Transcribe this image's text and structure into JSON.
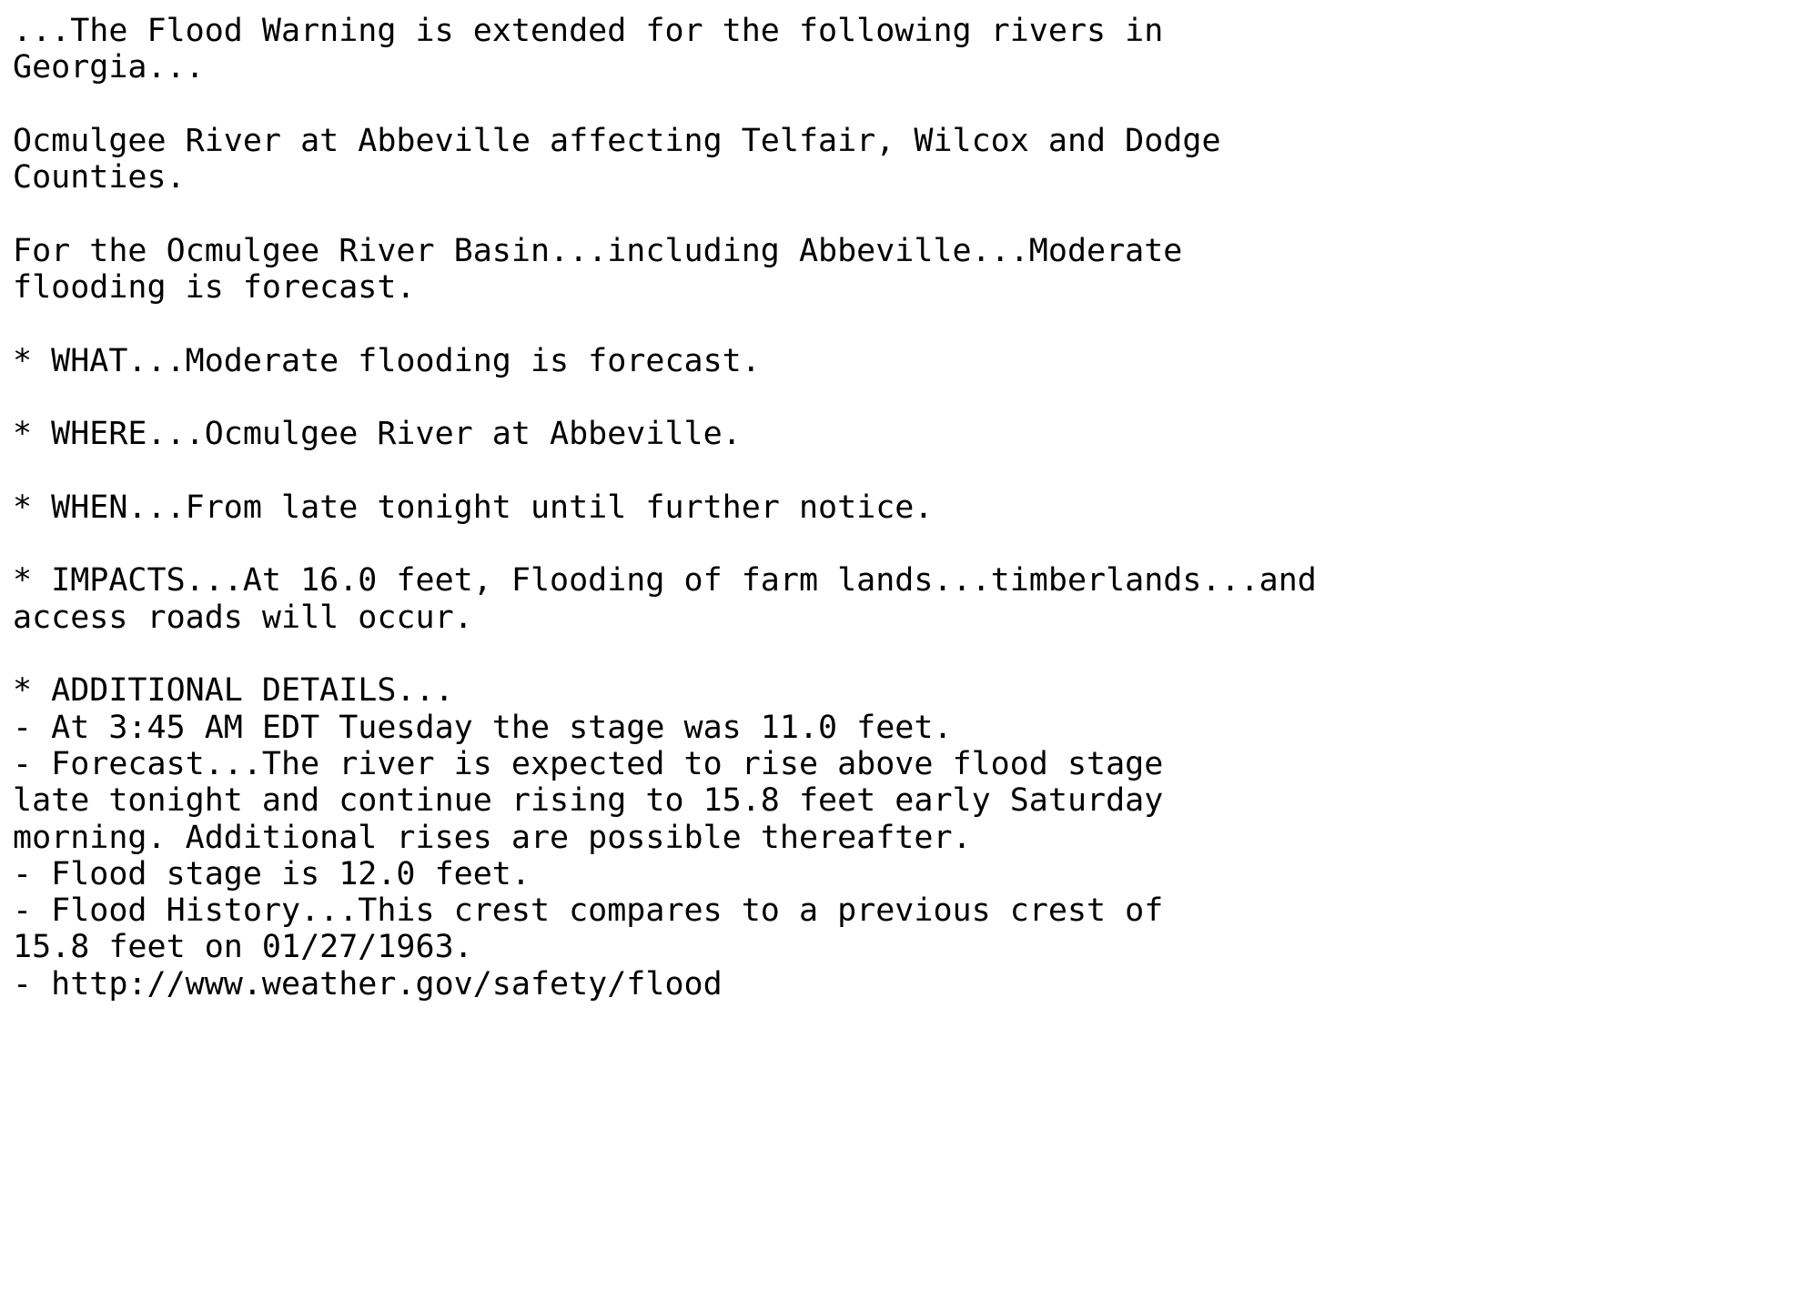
{
  "document": {
    "type": "nws-text-product",
    "product_name": "Flood Warning",
    "text_color": "#000000",
    "background_color": "#ffffff",
    "blocks": [
      {
        "id": "headline",
        "name": "headline-paragraph",
        "lines": [
          "...The Flood Warning is extended for the following rivers in",
          "Georgia..."
        ]
      },
      {
        "id": "location",
        "name": "affected-location-paragraph",
        "lines": [
          "Ocmulgee River at Abbeville affecting Telfair, Wilcox and Dodge",
          "Counties."
        ]
      },
      {
        "id": "basin",
        "name": "basin-summary-paragraph",
        "lines": [
          "For the Ocmulgee River Basin...including Abbeville...Moderate",
          "flooding is forecast."
        ]
      },
      {
        "id": "what",
        "name": "what-bullet",
        "lines": [
          "* WHAT...Moderate flooding is forecast."
        ]
      },
      {
        "id": "where",
        "name": "where-bullet",
        "lines": [
          "* WHERE...Ocmulgee River at Abbeville."
        ]
      },
      {
        "id": "when",
        "name": "when-bullet",
        "lines": [
          "* WHEN...From late tonight until further notice."
        ]
      },
      {
        "id": "impacts",
        "name": "impacts-bullet",
        "lines": [
          "* IMPACTS...At 16.0 feet, Flooding of farm lands...timberlands...and",
          "access roads will occur."
        ]
      },
      {
        "id": "additional",
        "name": "additional-details-bullet",
        "lines": [
          "* ADDITIONAL DETAILS...",
          "- At 3:45 AM EDT Tuesday the stage was 11.0 feet.",
          "- Forecast...The river is expected to rise above flood stage",
          "late tonight and continue rising to 15.8 feet early Saturday",
          "morning. Additional rises are possible thereafter.",
          "- Flood stage is 12.0 feet.",
          "- Flood History...This crest compares to a previous crest of",
          "15.8 feet on 01/27/1963.",
          "- http://www.weather.gov/safety/flood"
        ]
      }
    ],
    "values": {
      "river": "Ocmulgee River",
      "gauge_location": "Abbeville",
      "state": "Georgia",
      "counties": [
        "Telfair",
        "Wilcox",
        "Dodge"
      ],
      "severity": "Moderate",
      "impact_stage_feet": "16.0",
      "observation_time": "3:45 AM EDT Tuesday",
      "observed_stage_feet": "11.0",
      "forecast_crest_feet": "15.8",
      "forecast_crest_time": "early Saturday morning",
      "flood_stage_feet": "12.0",
      "previous_crest_feet": "15.8",
      "previous_crest_date": "01/27/1963",
      "safety_url": "http://www.weather.gov/safety/flood"
    }
  }
}
